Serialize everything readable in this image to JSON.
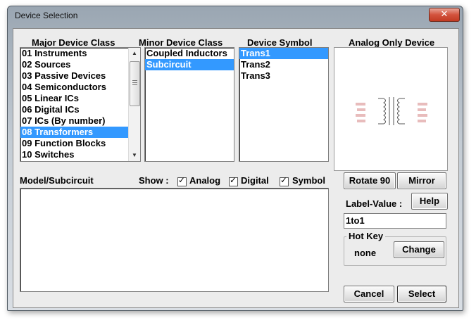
{
  "window": {
    "title": "Device Selection",
    "close_glyph": "✕"
  },
  "columns": {
    "major": "Major Device Class",
    "minor": "Minor Device Class",
    "symbol": "Device Symbol",
    "analog_only": "Analog Only Device"
  },
  "major_classes": [
    "01 Instruments",
    "02 Sources",
    "03 Passive Devices",
    "04 Semiconductors",
    "05 Linear ICs",
    "06 Digital ICs",
    "07 ICs (By number)",
    "08 Transformers",
    "09 Function Blocks",
    "10 Switches"
  ],
  "major_selected": 7,
  "minor_classes": [
    "Coupled Inductors",
    "Subcircuit"
  ],
  "minor_selected": 1,
  "symbols": [
    "Trans1",
    "Trans2",
    "Trans3"
  ],
  "symbol_selected": 0,
  "model_label": "Model/Subcircuit",
  "show": {
    "label": "Show :",
    "analog": "Analog",
    "digital": "Digital",
    "symbol": "Symbol",
    "check_glyph": "✓"
  },
  "buttons": {
    "rotate": "Rotate 90",
    "mirror": "Mirror",
    "help": "Help",
    "change": "Change",
    "cancel": "Cancel",
    "select": "Select"
  },
  "label_value": {
    "label": "Label-Value :",
    "value": "1to1"
  },
  "hotkey": {
    "legend": "Hot Key",
    "value": "none"
  },
  "icons": {
    "close": "close-icon",
    "scroll_up": "arrow-up-icon",
    "scroll_down": "arrow-down-icon"
  }
}
